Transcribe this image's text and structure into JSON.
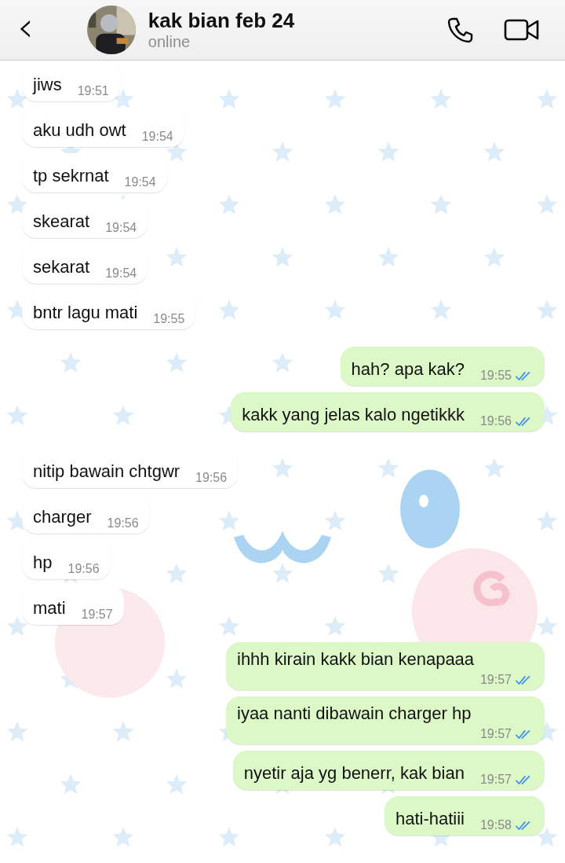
{
  "header": {
    "back": "‹",
    "name": "kak bian feb 24",
    "status": "online"
  },
  "messages": [
    {
      "kind": "received",
      "text": "jiws",
      "time": "19:51"
    },
    {
      "kind": "received",
      "text": "aku udh owt",
      "time": "19:54"
    },
    {
      "kind": "received",
      "text": "tp sekrnat",
      "time": "19:54"
    },
    {
      "kind": "received",
      "text": "skearat",
      "time": "19:54"
    },
    {
      "kind": "received",
      "text": "sekarat",
      "time": "19:54"
    },
    {
      "kind": "received",
      "text": "bntr lagu mati",
      "time": "19:55"
    },
    {
      "kind": "sent",
      "text": "hah? apa kak?",
      "time": "19:55",
      "read": true
    },
    {
      "kind": "sent",
      "text": "kakk yang jelas kalo ngetikkk",
      "time": "19:56",
      "read": true
    },
    {
      "kind": "received",
      "text": "nitip bawain chtgwr",
      "time": "19:56"
    },
    {
      "kind": "received",
      "text": "charger",
      "time": "19:56"
    },
    {
      "kind": "received",
      "text": "hp",
      "time": "19:56"
    },
    {
      "kind": "received",
      "text": "mati",
      "time": "19:57"
    },
    {
      "kind": "sent",
      "text": "ihhh kirain kakk bian kenapaaa",
      "time": "19:57",
      "read": true
    },
    {
      "kind": "sent",
      "text": "iyaa nanti dibawain charger hp",
      "time": "19:57",
      "read": true
    },
    {
      "kind": "sent",
      "text": "nyetir aja yg benerr, kak bian",
      "time": "19:57",
      "read": true
    },
    {
      "kind": "sent",
      "text": "hati-hatiii",
      "time": "19:58",
      "read": true
    }
  ]
}
